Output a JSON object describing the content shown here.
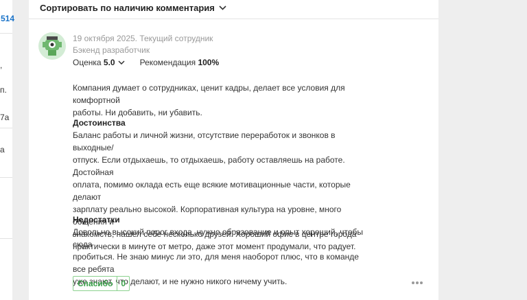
{
  "left_strip": {
    "fragments": [
      "514",
      ",",
      "п.",
      "7а",
      "а"
    ]
  },
  "sort": {
    "label": "Сортировать по наличию комментария"
  },
  "review": {
    "date_status": "19 октября 2025. Текущий сотрудник",
    "position": "Бэкенд разработчик",
    "rating_label": "Оценка",
    "rating_value": "5.0",
    "recommendation_label": "Рекомендация",
    "recommendation_value": "100%",
    "summary": [
      "Компания думает о сотрудниках, ценит кадры, делает все условия для комфортной",
      "работы. Ни добавить, ни убавить."
    ],
    "pros_title": "Достоинства",
    "pros": [
      "Баланс работы и личной жизни, отсутствие переработок и звонков в выходные/",
      "отпуск. Если отдыхаешь, то отдыхаешь, работу оставляешь на работе. Достойная",
      "оплата, помимо оклада есть еще всякие мотивационные части, которые делают",
      "зарплату реально высокой. Корпоративная культура на уровне, много общения и",
      "знакомств, нашел себе несколько друзей. Хороший офис в центре города",
      "практически в минуте от метро, даже этот момент продумали, что радует."
    ],
    "cons_title": "Недостатки",
    "cons": [
      "Довольно высокий порог входа, нужно образование и опыт хороший, чтобы сюда",
      "пробиться. Не знаю минус ли это, для меня наоборот плюс, что в команде все ребята",
      "уже знают, что делают, и не нужно никого ничему учить."
    ],
    "like_label": "Спасибо",
    "like_count": "0"
  },
  "colors": {
    "accent_green": "#3aa14a",
    "link_blue": "#1a73c8",
    "avatar_bg": "#d3ecd5"
  },
  "icons": [
    "chevron-down-icon",
    "avatar-robot-icon",
    "more-dots-icon"
  ]
}
